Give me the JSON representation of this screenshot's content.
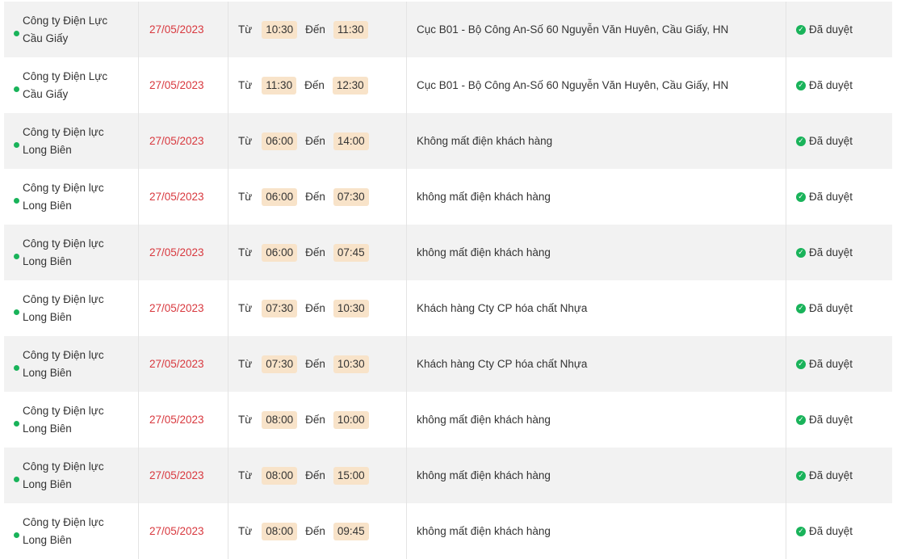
{
  "labels": {
    "from": "Từ",
    "to": "Đến"
  },
  "colors": {
    "date": "#d8383e",
    "time_badge": "#f8e3c9",
    "status_dot": "#19b35a"
  },
  "rows": [
    {
      "company": "Công ty Điện Lực Cầu Giấy",
      "date": "27/05/2023",
      "from": "10:30",
      "to": "11:30",
      "desc": "Cục B01 - Bộ Công An-Số 60 Nguyễn Văn Huyên, Cầu Giấy, HN",
      "status": "Đã duyệt"
    },
    {
      "company": "Công ty Điện Lực Cầu Giấy",
      "date": "27/05/2023",
      "from": "11:30",
      "to": "12:30",
      "desc": "Cục B01 - Bộ Công An-Số 60 Nguyễn Văn Huyên, Cầu Giấy, HN",
      "status": "Đã duyệt"
    },
    {
      "company": "Công ty Điện lực Long Biên",
      "date": "27/05/2023",
      "from": "06:00",
      "to": "14:00",
      "desc": "Không mất điện khách hàng",
      "status": "Đã duyệt"
    },
    {
      "company": "Công ty Điện lực Long Biên",
      "date": "27/05/2023",
      "from": "06:00",
      "to": "07:30",
      "desc": "không mất điện khách hàng",
      "status": "Đã duyệt"
    },
    {
      "company": "Công ty Điện lực Long Biên",
      "date": "27/05/2023",
      "from": "06:00",
      "to": "07:45",
      "desc": "không mất điện khách hàng",
      "status": "Đã duyệt"
    },
    {
      "company": "Công ty Điện lực Long Biên",
      "date": "27/05/2023",
      "from": "07:30",
      "to": "10:30",
      "desc": "Khách hàng Cty CP hóa chất Nhựa",
      "status": "Đã duyệt"
    },
    {
      "company": "Công ty Điện lực Long Biên",
      "date": "27/05/2023",
      "from": "07:30",
      "to": "10:30",
      "desc": "Khách hàng Cty CP hóa chất Nhựa",
      "status": "Đã duyệt"
    },
    {
      "company": "Công ty Điện lực Long Biên",
      "date": "27/05/2023",
      "from": "08:00",
      "to": "10:00",
      "desc": "không mất điện khách hàng",
      "status": "Đã duyệt"
    },
    {
      "company": "Công ty Điện lực Long Biên",
      "date": "27/05/2023",
      "from": "08:00",
      "to": "15:00",
      "desc": "không mất điện khách hàng",
      "status": "Đã duyệt"
    },
    {
      "company": "Công ty Điện lực Long Biên",
      "date": "27/05/2023",
      "from": "08:00",
      "to": "09:45",
      "desc": "không mất điện khách hàng",
      "status": "Đã duyệt"
    }
  ]
}
